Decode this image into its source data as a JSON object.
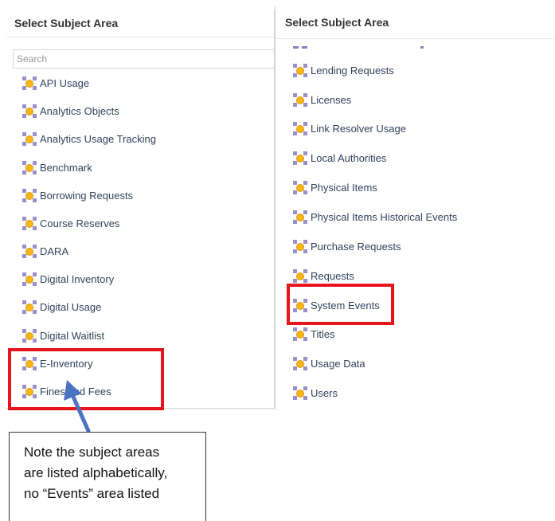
{
  "left_panel": {
    "title": "Select Subject Area",
    "search_placeholder": "Search",
    "items": [
      "API Usage",
      "Analytics Objects",
      "Analytics Usage Tracking",
      "Benchmark",
      "Borrowing Requests",
      "Course Reserves",
      "DARA",
      "Digital Inventory",
      "Digital Usage",
      "Digital Waitlist",
      "E-Inventory",
      "Fines and Fees"
    ]
  },
  "right_panel": {
    "title": "Select Subject Area",
    "items": [
      "Lending Requests",
      "Licenses",
      "Link Resolver Usage",
      "Local Authorities",
      "Physical Items",
      "Physical Items Historical Events",
      "Purchase Requests",
      "Requests",
      "System Events",
      "Titles",
      "Usage Data",
      "Users"
    ]
  },
  "note": {
    "lines": [
      "Note the subject areas",
      "are listed alphabetically,",
      "no “Events” area listed"
    ]
  },
  "colors": {
    "highlight": "#e8141c",
    "arrow": "#4a73c4",
    "icon_circle": "#f5b51b",
    "icon_squares": "#9b8fc9",
    "item_text": "#32425c"
  },
  "icons": {
    "subject_area_icon": "subject-area-icon",
    "pointer_arrow": "arrow-icon"
  }
}
